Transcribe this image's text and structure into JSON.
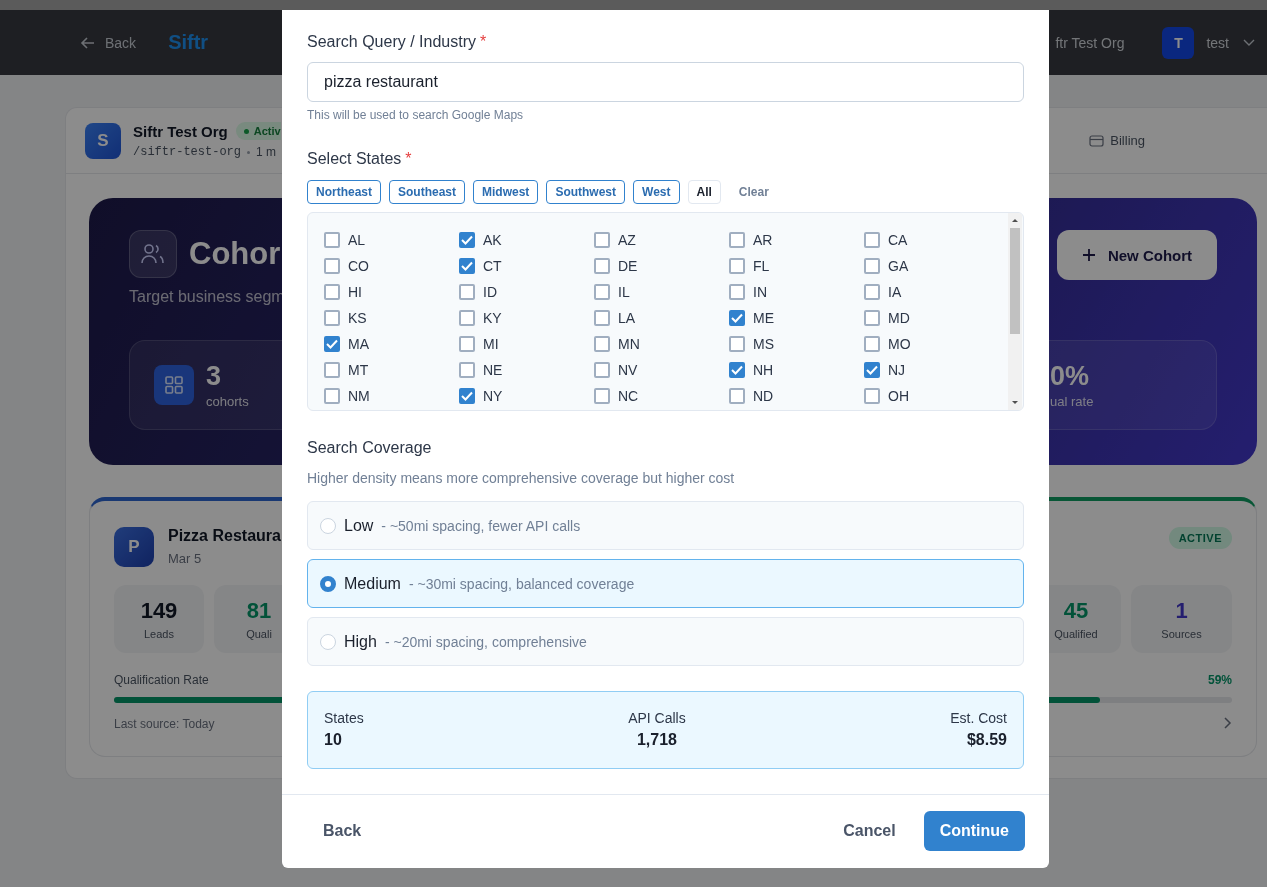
{
  "header": {
    "back": "Back",
    "logo": "Siftr",
    "org": "ftr Test Org",
    "avatar": "T",
    "user": "test"
  },
  "org_bar": {
    "avatar": "S",
    "name": "Siftr Test Org",
    "status": "Activ",
    "slug": "/siftr-test-org",
    "meta": "1 m",
    "billing": "Billing"
  },
  "hero": {
    "title": "Cohor",
    "subtitle": "Target business segm",
    "new_button": "New Cohort",
    "stats": [
      {
        "value": "3",
        "label": "cohorts",
        "kind": "icon"
      },
      {
        "value": "0%",
        "label": "ual rate",
        "kind": "plain"
      }
    ]
  },
  "cards": [
    {
      "avatar": "P",
      "title": "Pizza Restaura",
      "date": "Mar 5",
      "stats": [
        {
          "value": "149",
          "label": "Leads",
          "kind": "total"
        },
        {
          "value": "81",
          "label": "Quali",
          "kind": "qualified"
        }
      ],
      "rate_label": "Qualification Rate",
      "level": 0.54,
      "footer": "Last source: Today"
    },
    {
      "status": "ACTIVE",
      "stats": [
        {
          "value": "45",
          "label": "Qualified",
          "kind": "qualified"
        },
        {
          "value": "1",
          "label": "Sources",
          "kind": "sources"
        }
      ],
      "rate": "59%",
      "level": 0.59
    }
  ],
  "dialog": {
    "query": {
      "label": "Search Query / Industry",
      "required_mark": "*",
      "value": "pizza restaurant",
      "hint": "This will be used to search Google Maps"
    },
    "states": {
      "label": "Select States",
      "required_mark": "*",
      "presets": [
        {
          "label": "Northeast",
          "kind": "region"
        },
        {
          "label": "Southeast",
          "kind": "region"
        },
        {
          "label": "Midwest",
          "kind": "region"
        },
        {
          "label": "Southwest",
          "kind": "region"
        },
        {
          "label": "West",
          "kind": "region"
        },
        {
          "label": "All",
          "kind": "all"
        },
        {
          "label": "Clear",
          "kind": "clear"
        }
      ],
      "items": [
        {
          "code": "AL",
          "checked": false
        },
        {
          "code": "AK",
          "checked": true
        },
        {
          "code": "AZ",
          "checked": false
        },
        {
          "code": "AR",
          "checked": false
        },
        {
          "code": "CA",
          "checked": false
        },
        {
          "code": "CO",
          "checked": false
        },
        {
          "code": "CT",
          "checked": true
        },
        {
          "code": "DE",
          "checked": false
        },
        {
          "code": "FL",
          "checked": false
        },
        {
          "code": "GA",
          "checked": false
        },
        {
          "code": "HI",
          "checked": false
        },
        {
          "code": "ID",
          "checked": false
        },
        {
          "code": "IL",
          "checked": false
        },
        {
          "code": "IN",
          "checked": false
        },
        {
          "code": "IA",
          "checked": false
        },
        {
          "code": "KS",
          "checked": false
        },
        {
          "code": "KY",
          "checked": false
        },
        {
          "code": "LA",
          "checked": false
        },
        {
          "code": "ME",
          "checked": true
        },
        {
          "code": "MD",
          "checked": false
        },
        {
          "code": "MA",
          "checked": true
        },
        {
          "code": "MI",
          "checked": false
        },
        {
          "code": "MN",
          "checked": false
        },
        {
          "code": "MS",
          "checked": false
        },
        {
          "code": "MO",
          "checked": false
        },
        {
          "code": "MT",
          "checked": false
        },
        {
          "code": "NE",
          "checked": false
        },
        {
          "code": "NV",
          "checked": false
        },
        {
          "code": "NH",
          "checked": true
        },
        {
          "code": "NJ",
          "checked": true
        },
        {
          "code": "NM",
          "checked": false
        },
        {
          "code": "NY",
          "checked": true
        },
        {
          "code": "NC",
          "checked": false
        },
        {
          "code": "ND",
          "checked": false
        },
        {
          "code": "OH",
          "checked": false
        }
      ]
    },
    "coverage": {
      "label": "Search Coverage",
      "description": "Higher density means more comprehensive coverage but higher cost",
      "options": [
        {
          "label": "Low",
          "detail": "- ~50mi spacing, fewer API calls",
          "selected": false
        },
        {
          "label": "Medium",
          "detail": "- ~30mi spacing, balanced coverage",
          "selected": true
        },
        {
          "label": "High",
          "detail": "- ~20mi spacing, comprehensive",
          "selected": false
        }
      ]
    },
    "summary": [
      {
        "label": "States",
        "value": "10"
      },
      {
        "label": "API Calls",
        "value": "1,718"
      },
      {
        "label": "Est. Cost",
        "value": "$8.59"
      }
    ],
    "buttons": {
      "back": "Back",
      "cancel": "Cancel",
      "continue": "Continue"
    }
  }
}
